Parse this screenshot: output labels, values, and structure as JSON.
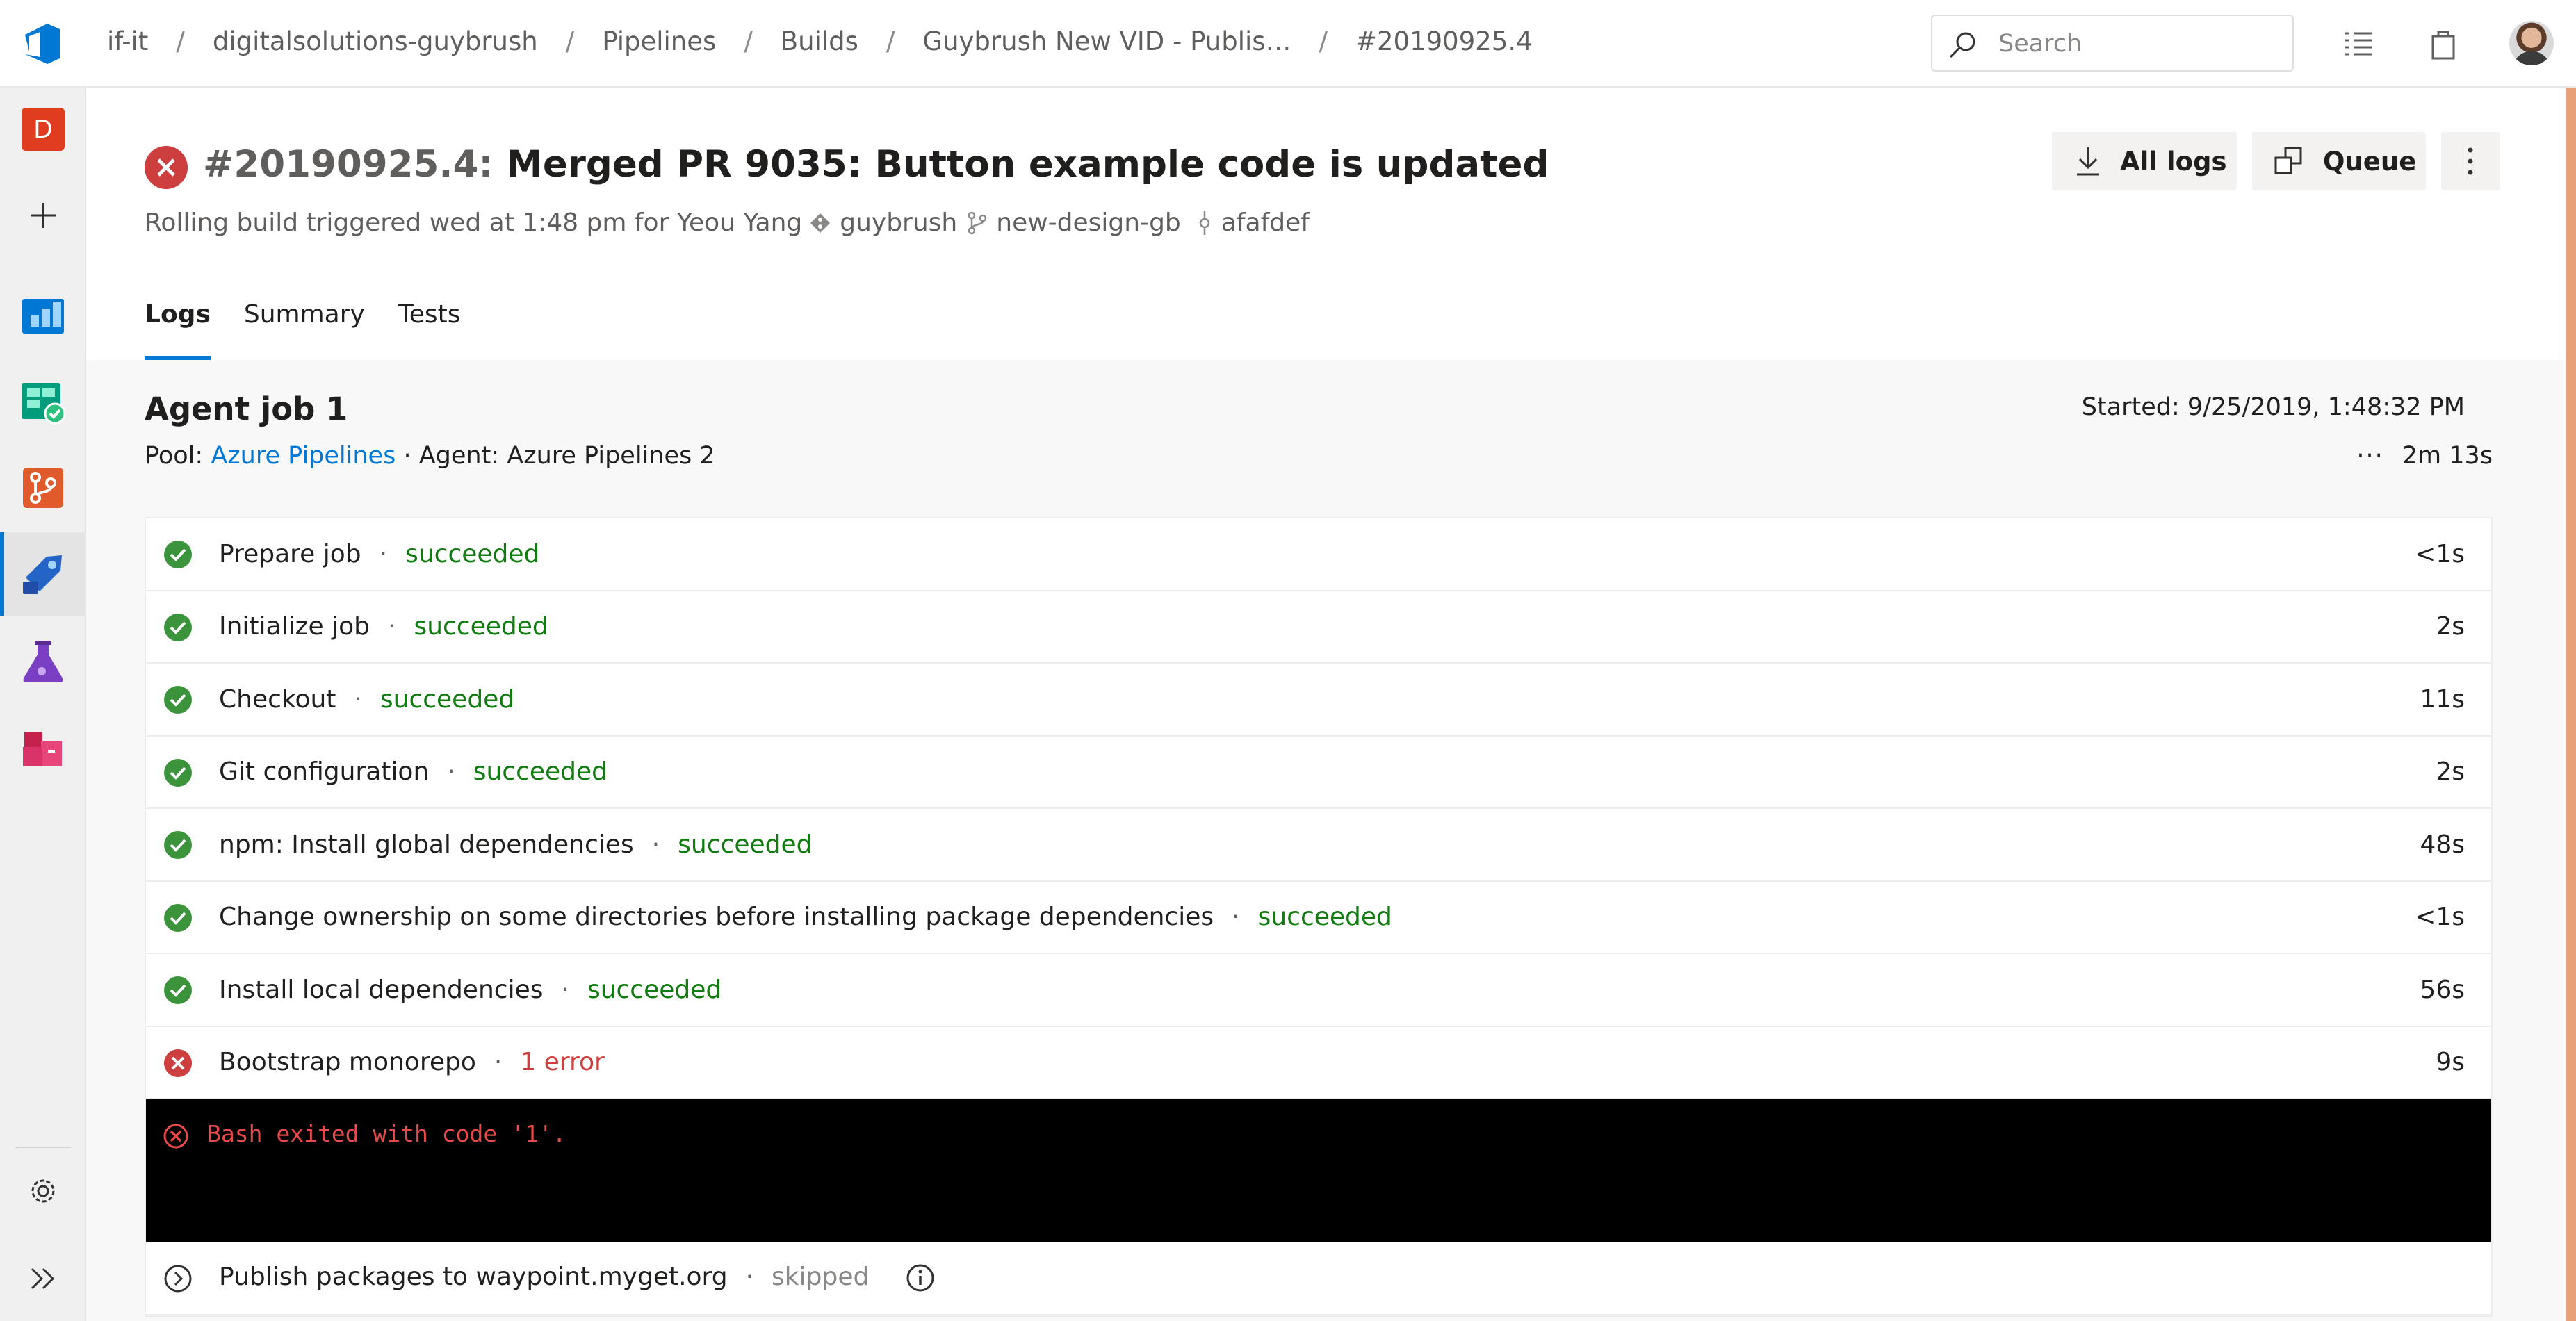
{
  "breadcrumb": {
    "items": [
      "if-it",
      "digitalsolutions-guybrush",
      "Pipelines",
      "Builds",
      "Guybrush New VID - Publis…",
      "#20190925.4"
    ],
    "separator": "/"
  },
  "search": {
    "placeholder": "Search"
  },
  "nav": {
    "org_initial": "D"
  },
  "header": {
    "build_number": "#20190925.4:",
    "title": "Merged PR 9035: Button example code is updated",
    "trigger_text": "Rolling build triggered wed at 1:48 pm for Yeou Yang",
    "repo": "guybrush",
    "branch": "new-design-gb",
    "commit": "afafdef",
    "all_logs_label": "All logs",
    "queue_label": "Queue"
  },
  "tabs": [
    {
      "label": "Logs",
      "active": true
    },
    {
      "label": "Summary",
      "active": false
    },
    {
      "label": "Tests",
      "active": false
    }
  ],
  "job": {
    "title": "Agent job 1",
    "pool_label": "Pool:",
    "pool_link": "Azure Pipelines",
    "agent_text": "· Agent: Azure Pipelines 2",
    "started": "Started: 9/25/2019, 1:48:32 PM",
    "duration_dots": "···",
    "duration": "2m 13s"
  },
  "steps": [
    {
      "name": "Prepare job",
      "status": "succeeded",
      "state": "ok",
      "time": "<1s"
    },
    {
      "name": "Initialize job",
      "status": "succeeded",
      "state": "ok",
      "time": "2s"
    },
    {
      "name": "Checkout",
      "status": "succeeded",
      "state": "ok",
      "time": "11s"
    },
    {
      "name": "Git configuration",
      "status": "succeeded",
      "state": "ok",
      "time": "2s"
    },
    {
      "name": "npm: Install global dependencies",
      "status": "succeeded",
      "state": "ok",
      "time": "48s"
    },
    {
      "name": "Change ownership on some directories before installing package dependencies",
      "status": "succeeded",
      "state": "ok",
      "time": "<1s"
    },
    {
      "name": "Install local dependencies",
      "status": "succeeded",
      "state": "ok",
      "time": "56s"
    },
    {
      "name": "Bootstrap monorepo",
      "status": "1 error",
      "state": "error",
      "time": "9s"
    }
  ],
  "console": {
    "message": "Bash exited with code '1'."
  },
  "skipped_step": {
    "name": "Publish packages to waypoint.myget.org",
    "status": "skipped"
  },
  "colors": {
    "accent": "#0078d4",
    "success": "#107c10",
    "error": "#cd3e3e",
    "org_badge": "#e03c20"
  },
  "icons": {
    "success": "check-circle-icon",
    "error": "error-circle-icon",
    "skipped": "chevron-circle-icon"
  }
}
